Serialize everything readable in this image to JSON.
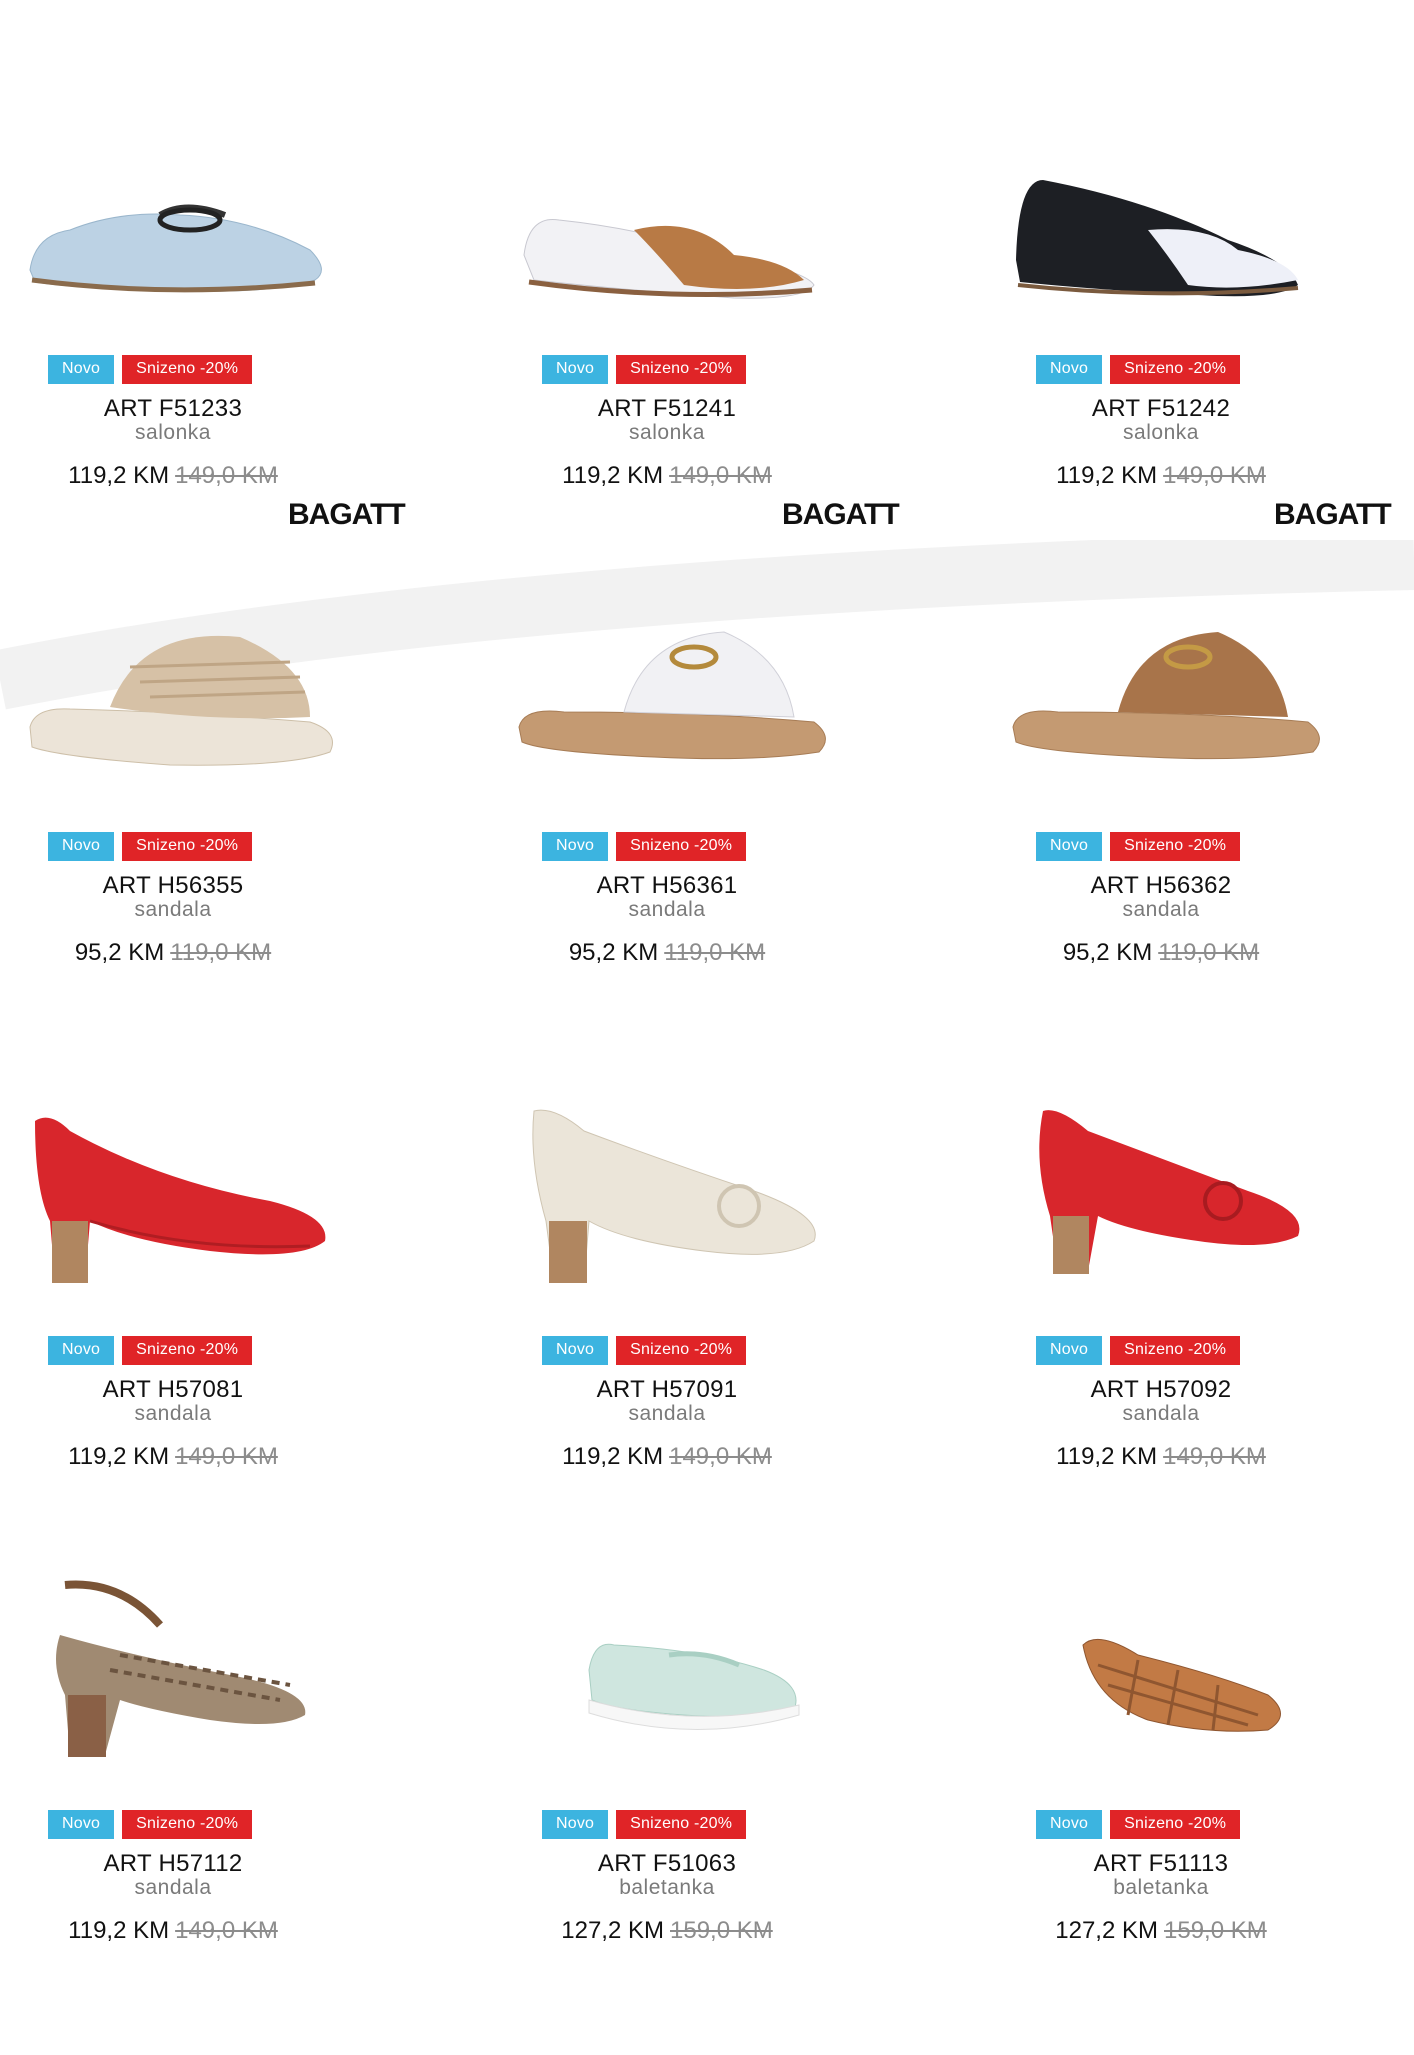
{
  "brand": "BAGATT",
  "colors": {
    "new_badge": "#3cb4e0",
    "sale_badge": "#e02427",
    "old_price": "#8c8c8c"
  },
  "products": [
    {
      "art": "ART F51233",
      "category": "salonka",
      "price": "119,2 KM",
      "old_price": "149,0 KM",
      "badge_new": "Novo",
      "badge_sale": "Snizeno -20%",
      "shoe": "light-blue-loafer"
    },
    {
      "art": "ART F51241",
      "category": "salonka",
      "price": "119,2 KM",
      "old_price": "149,0 KM",
      "badge_new": "Novo",
      "badge_sale": "Snizeno -20%",
      "shoe": "white-tan-cross-flat"
    },
    {
      "art": "ART F51242",
      "category": "salonka",
      "price": "119,2 KM",
      "old_price": "149,0 KM",
      "badge_new": "Novo",
      "badge_sale": "Snizeno -20%",
      "shoe": "black-white-cross-flat"
    },
    {
      "art": "ART H56355",
      "category": "sandala",
      "price": "95,2 KM",
      "old_price": "119,0 KM",
      "badge_new": "Novo",
      "badge_sale": "Snizeno -20%",
      "shoe": "beige-woven-slide"
    },
    {
      "art": "ART H56361",
      "category": "sandala",
      "price": "95,2 KM",
      "old_price": "119,0 KM",
      "badge_new": "Novo",
      "badge_sale": "Snizeno -20%",
      "shoe": "white-buckle-slide"
    },
    {
      "art": "ART H56362",
      "category": "sandala",
      "price": "95,2 KM",
      "old_price": "119,0 KM",
      "badge_new": "Novo",
      "badge_sale": "Snizeno -20%",
      "shoe": "brown-buckle-slide"
    },
    {
      "art": "ART H57081",
      "category": "sandala",
      "price": "119,2 KM",
      "old_price": "149,0 KM",
      "badge_new": "Novo",
      "badge_sale": "Snizeno -20%",
      "shoe": "red-heel-pump"
    },
    {
      "art": "ART H57091",
      "category": "sandala",
      "price": "119,2 KM",
      "old_price": "149,0 KM",
      "badge_new": "Novo",
      "badge_sale": "Snizeno -20%",
      "shoe": "cream-peeptoe-heel"
    },
    {
      "art": "ART H57092",
      "category": "sandala",
      "price": "119,2 KM",
      "old_price": "149,0 KM",
      "badge_new": "Novo",
      "badge_sale": "Snizeno -20%",
      "shoe": "red-peeptoe-heel"
    },
    {
      "art": "ART H57112",
      "category": "sandala",
      "price": "119,2 KM",
      "old_price": "149,0 KM",
      "badge_new": "Novo",
      "badge_sale": "Snizeno -20%",
      "shoe": "snake-slingback"
    },
    {
      "art": "ART F51063",
      "category": "baletanka",
      "price": "127,2 KM",
      "old_price": "159,0 KM",
      "badge_new": "Novo",
      "badge_sale": "Snizeno -20%",
      "shoe": "mint-loafer"
    },
    {
      "art": "ART F51113",
      "category": "baletanka",
      "price": "127,2 KM",
      "old_price": "159,0 KM",
      "badge_new": "Novo",
      "badge_sale": "Snizeno -20%",
      "shoe": "tan-woven-ballet"
    }
  ]
}
